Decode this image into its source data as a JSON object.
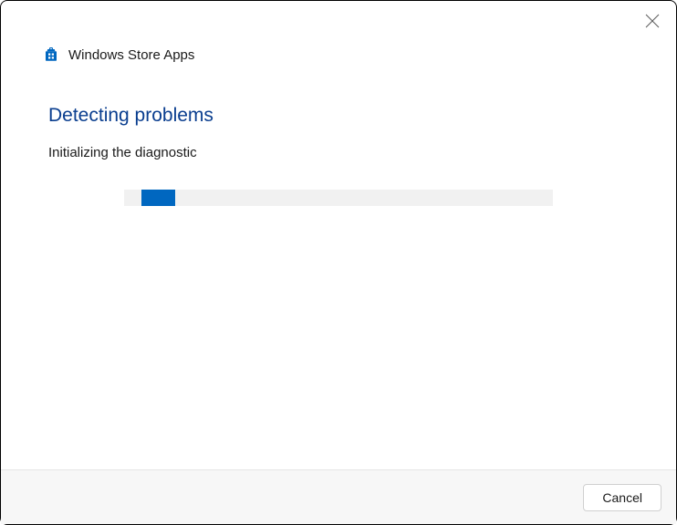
{
  "header": {
    "title": "Windows Store Apps"
  },
  "content": {
    "heading": "Detecting problems",
    "status": "Initializing the diagnostic"
  },
  "progress": {
    "left_percent": "4",
    "width_percent": "8"
  },
  "footer": {
    "cancel_label": "Cancel"
  },
  "colors": {
    "accent": "#0067c0",
    "heading": "#0a3e8f"
  }
}
